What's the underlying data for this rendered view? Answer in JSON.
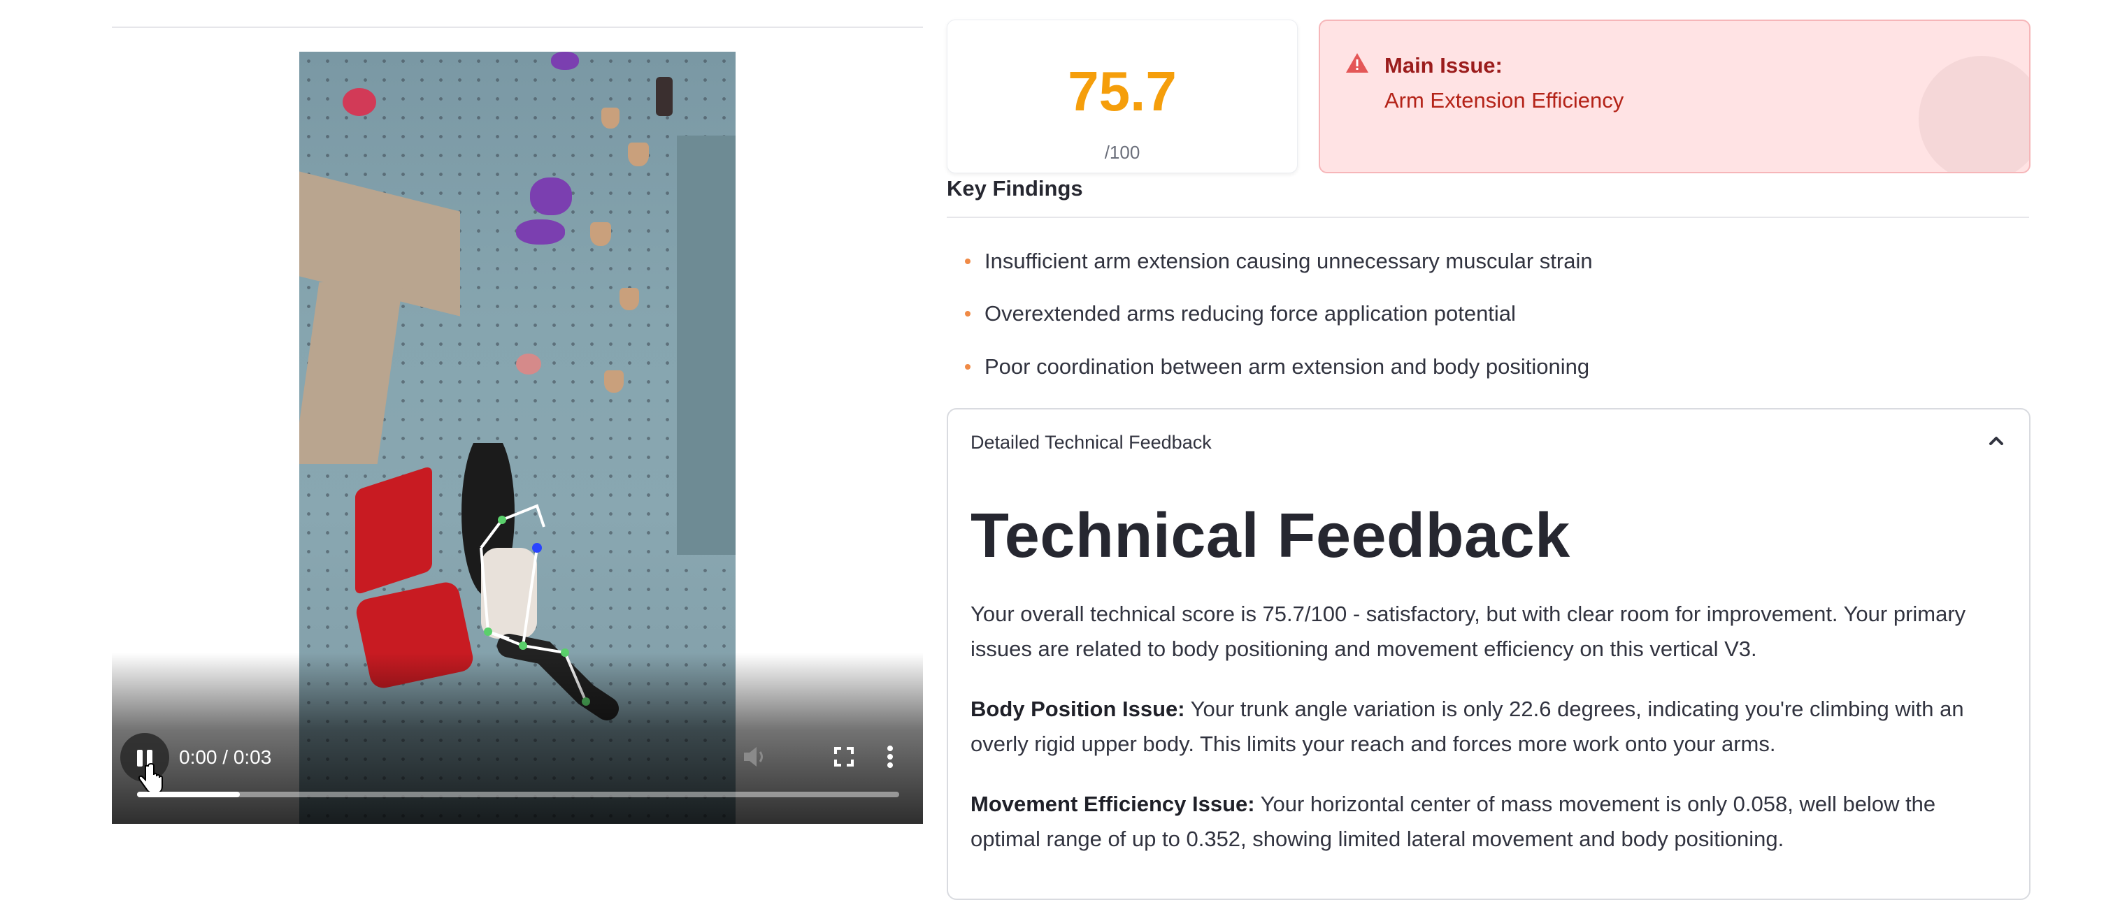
{
  "video": {
    "time_display": "0:00 / 0:03",
    "progress_fraction": 0.135,
    "controls": {
      "play_state_icon": "pause-icon",
      "volume_icon": "volume-icon",
      "fullscreen_icon": "fullscreen-icon",
      "more_icon": "more-vertical-icon"
    }
  },
  "score": {
    "value": "75.7",
    "denominator": "/100",
    "color": "#f59e0b"
  },
  "main_issue": {
    "title": "Main Issue:",
    "text": "Arm Extension Efficiency",
    "icon": "warning-icon"
  },
  "key_findings": {
    "heading": "Key Findings",
    "items": [
      "Insufficient arm extension causing unnecessary muscular strain",
      "Overextended arms reducing force application potential",
      "Poor coordination between arm extension and body positioning"
    ]
  },
  "expander": {
    "label": "Detailed Technical Feedback",
    "heading": "Technical Feedback",
    "intro": "Your overall technical score is 75.7/100 - satisfactory, but with clear room for improvement. Your primary issues are related to body positioning and movement efficiency on this vertical V3.",
    "body_label": "Body Position Issue:",
    "body_text": " Your trunk angle variation is only 22.6 degrees, indicating you're climbing with an overly rigid upper body. This limits your reach and forces more work onto your arms.",
    "movement_label": "Movement Efficiency Issue:",
    "movement_text": " Your horizontal center of mass movement is only 0.058, well below the optimal range of up to 0.352, showing limited lateral movement and body positioning."
  },
  "colors": {
    "accent_orange": "#f59e0b",
    "issue_bg": "#ffe3e4",
    "issue_text": "#9b1c1c",
    "bullet": "#f08a46"
  }
}
